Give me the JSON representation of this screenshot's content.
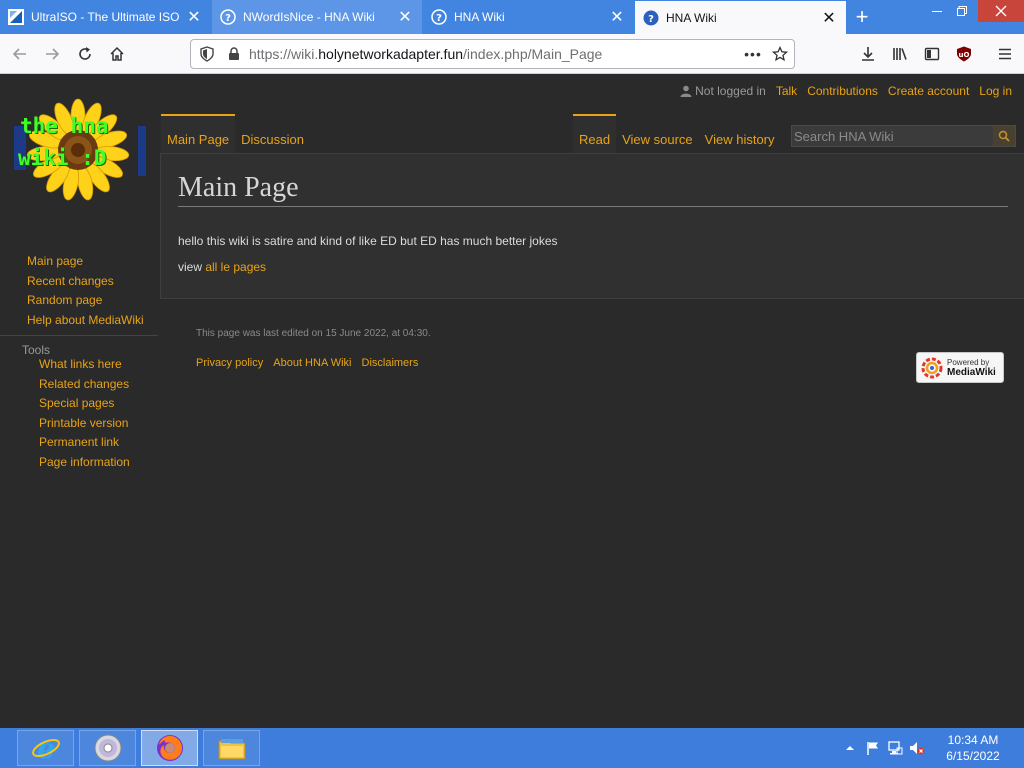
{
  "browser": {
    "tabs": [
      {
        "title": "UltraISO - The Ultimate ISO",
        "icon": "ultraiso-icon"
      },
      {
        "title": "NWordIsNice - HNA Wiki",
        "icon": "wiki-globe-icon"
      },
      {
        "title": "HNA Wiki",
        "icon": "wiki-globe-icon"
      },
      {
        "title": "HNA Wiki",
        "icon": "wiki-globe-icon",
        "active": true
      }
    ],
    "url_prefix": "https://wiki.",
    "url_domain": "holynetworkadapter.fun",
    "url_path": "/index.php/Main_Page",
    "overflow_label": "•••",
    "accent_color": "#4285e1"
  },
  "wiki": {
    "logo": {
      "line1": "the hna",
      "line2": "wiki :D"
    },
    "personal_tools": {
      "not_logged_in": "Not logged in",
      "talk": "Talk",
      "contributions": "Contributions",
      "create_account": "Create account",
      "log_in": "Log in"
    },
    "namespace_tabs": {
      "main_page": "Main Page",
      "discussion": "Discussion"
    },
    "view_tabs": {
      "read": "Read",
      "view_source": "View source",
      "view_history": "View history"
    },
    "search": {
      "placeholder": "Search HNA Wiki"
    },
    "heading": "Main Page",
    "paragraph1": "hello this wiki is satire and kind of like ED but ED has much better jokes",
    "paragraph2_prefix": "view ",
    "paragraph2_link": "all le pages",
    "navigation": [
      "Main page",
      "Recent changes",
      "Random page",
      "Help about MediaWiki"
    ],
    "tools_heading": "Tools",
    "tools": [
      "What links here",
      "Related changes",
      "Special pages",
      "Printable version",
      "Permanent link",
      "Page information"
    ],
    "footer": {
      "last_edited": "This page was last edited on 15 June 2022, at 04:30.",
      "privacy": "Privacy policy",
      "about": "About HNA Wiki",
      "disclaimers": "Disclaimers",
      "powered_by_small": "Powered by",
      "powered_by_big": "MediaWiki"
    },
    "link_color": "#e8a317"
  },
  "taskbar": {
    "apps": [
      "internet-explorer-icon",
      "ultraiso-disc-icon",
      "firefox-icon",
      "file-explorer-icon"
    ],
    "time": "10:34 AM",
    "date": "6/15/2022"
  }
}
